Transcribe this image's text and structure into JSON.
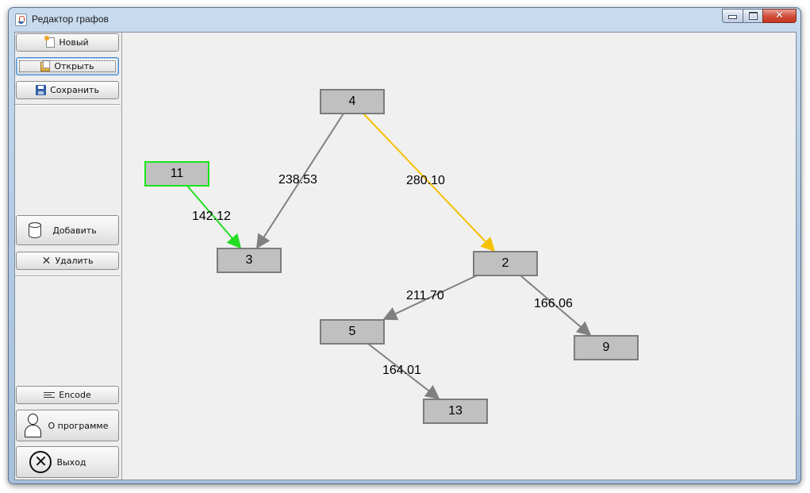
{
  "window": {
    "title": "Редактор графов"
  },
  "toolbar": {
    "new_label": "Новый",
    "open_label": "Открыть",
    "save_label": "Сохранить",
    "add_label": "Добавить",
    "delete_label": "Удалить",
    "encode_label": "Encode",
    "about_label": "О программе",
    "exit_label": "Выход"
  },
  "icons": {
    "new": "new-document-icon",
    "open": "open-folder-icon",
    "save": "floppy-disk-icon",
    "add": "database-cylinder-icon",
    "delete": "x-icon",
    "encode": "lines-icon",
    "about": "user-icon",
    "exit": "circle-x-icon"
  },
  "colors": {
    "edge_default": "#808080",
    "edge_highlight": "#f5c000",
    "edge_selected": "#22dd22",
    "node_fill": "#c0c0c0",
    "node_border": "#7c7c7c",
    "node_active_border": "#19e619"
  },
  "graph": {
    "nodes": [
      {
        "id": "11",
        "label": "11",
        "state": "active"
      },
      {
        "id": "4",
        "label": "4",
        "state": "normal"
      },
      {
        "id": "3",
        "label": "3",
        "state": "normal"
      },
      {
        "id": "2",
        "label": "2",
        "state": "normal"
      },
      {
        "id": "5",
        "label": "5",
        "state": "normal"
      },
      {
        "id": "9",
        "label": "9",
        "state": "normal"
      },
      {
        "id": "13",
        "label": "13",
        "state": "normal"
      }
    ],
    "edges": [
      {
        "from": "11",
        "to": "3",
        "weight": "142.12",
        "color": "#22dd22"
      },
      {
        "from": "4",
        "to": "3",
        "weight": "238.53",
        "color": "#808080"
      },
      {
        "from": "4",
        "to": "2",
        "weight": "280.10",
        "color": "#f5c000"
      },
      {
        "from": "2",
        "to": "5",
        "weight": "211.70",
        "color": "#808080"
      },
      {
        "from": "2",
        "to": "9",
        "weight": "166.06",
        "color": "#808080"
      },
      {
        "from": "5",
        "to": "13",
        "weight": "164.01",
        "color": "#808080"
      }
    ]
  }
}
